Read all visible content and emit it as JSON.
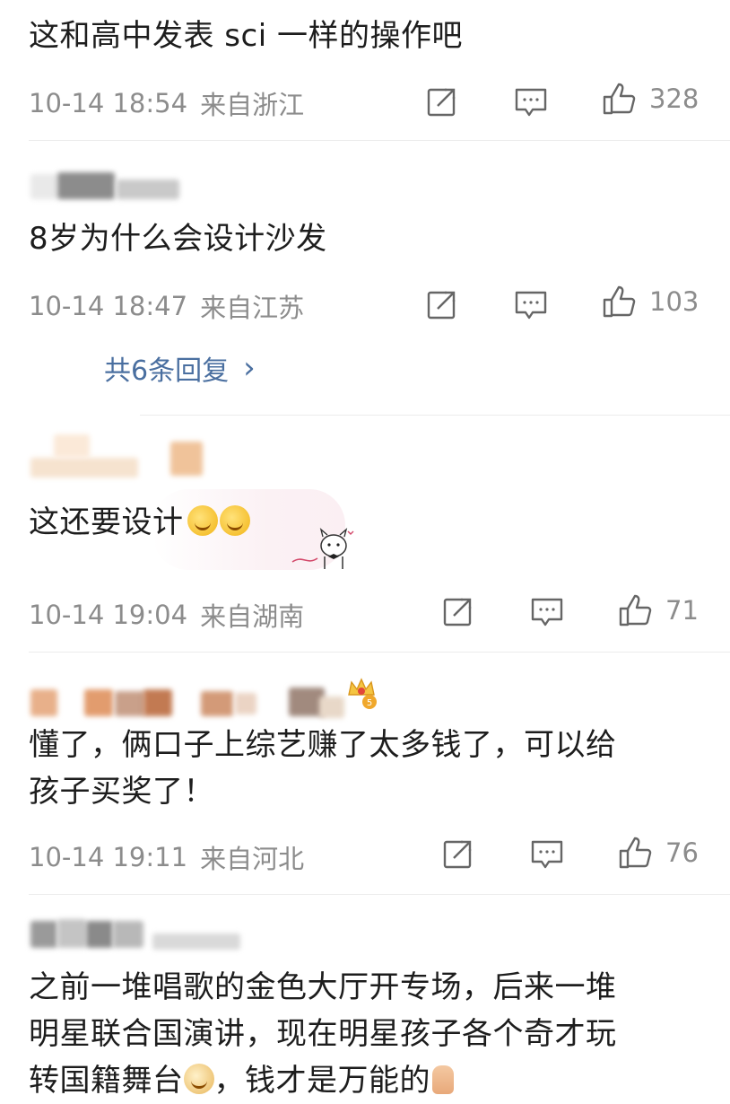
{
  "comments": [
    {
      "text": "这和高中发表 sci 一样的操作吧",
      "time": "10-14 18:54",
      "location": "来自浙江",
      "likes": "328"
    },
    {
      "username": "",
      "text": "8岁为什么会设计沙发",
      "time": "10-14 18:47",
      "location": "来自江苏",
      "likes": "103",
      "replies_link": "共6条回复",
      "replies_chevron": "›"
    },
    {
      "username": "",
      "text": "这还要设计",
      "time": "10-14 19:04",
      "location": "来自湖南",
      "likes": "71"
    },
    {
      "username": "",
      "text_line1": "懂了，俩口子上综艺赚了太多钱了，可以给",
      "text_line2": "孩子买奖了！",
      "time": "10-14 19:11",
      "location": "来自河北",
      "likes": "76"
    },
    {
      "username": "",
      "text_line1": "之前一堆唱歌的金色大厅开专场，后来一堆",
      "text_line2": "明星联合国演讲，现在明星孩子各个奇才玩",
      "text_line3": "转国籍舞台",
      "text_line3b": "，钱才是万能的"
    }
  ],
  "icons": {
    "share": "share-icon",
    "comment": "comment-icon",
    "like": "thumbs-up-icon"
  },
  "colors": {
    "meta_gray": "#8c8c8c",
    "link_blue": "#4a6fa0",
    "divider": "#ececec"
  }
}
